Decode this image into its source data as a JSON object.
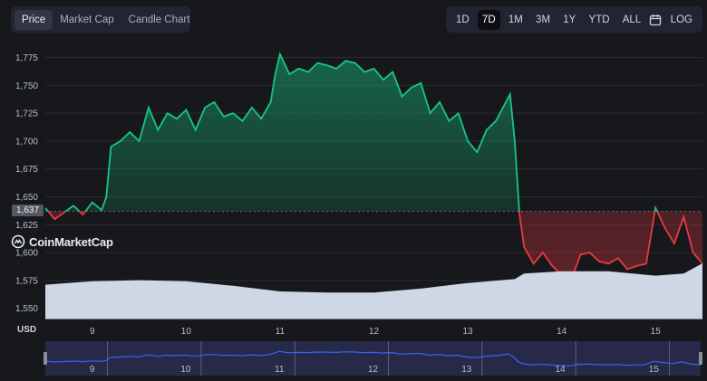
{
  "tabs": {
    "left": [
      {
        "label": "Price",
        "active": true
      },
      {
        "label": "Market Cap",
        "active": false
      },
      {
        "label": "Candle Chart",
        "active": false
      }
    ],
    "ranges": [
      {
        "label": "1D",
        "active": false
      },
      {
        "label": "7D",
        "active": true
      },
      {
        "label": "1M",
        "active": false
      },
      {
        "label": "3M",
        "active": false
      },
      {
        "label": "1Y",
        "active": false
      },
      {
        "label": "YTD",
        "active": false
      },
      {
        "label": "ALL",
        "active": false
      }
    ],
    "calendar_icon": "calendar-icon",
    "log_label": "LOG"
  },
  "watermark": "CoinMarketCap",
  "currency_label": "USD",
  "current_price_label": "1,637",
  "colors": {
    "up": "#16c784",
    "down": "#ea3943",
    "volume": "#cfd6e4",
    "navigator_line": "#3861fb",
    "background": "#17181b"
  },
  "chart_data": {
    "type": "line",
    "ylim": [
      1540,
      1790
    ],
    "yticks": [
      1550,
      1575,
      1600,
      1625,
      1650,
      1675,
      1700,
      1725,
      1750,
      1775
    ],
    "ytick_labels": [
      "1,550",
      "1,575",
      "1,600",
      "1,625",
      "1,650",
      "1,675",
      "1,700",
      "1,725",
      "1,750",
      "1,775"
    ],
    "xlim": [
      8.5,
      15.5
    ],
    "xticks": [
      9,
      10,
      11,
      12,
      13,
      14,
      15
    ],
    "xtick_labels": [
      "9",
      "10",
      "11",
      "12",
      "13",
      "14",
      "15"
    ],
    "reference_price": 1637,
    "price_series": {
      "x": [
        8.5,
        8.6,
        8.7,
        8.8,
        8.9,
        9.0,
        9.1,
        9.15,
        9.2,
        9.3,
        9.4,
        9.5,
        9.6,
        9.7,
        9.8,
        9.9,
        10.0,
        10.1,
        10.2,
        10.3,
        10.4,
        10.5,
        10.6,
        10.7,
        10.8,
        10.9,
        10.95,
        11.0,
        11.1,
        11.2,
        11.3,
        11.4,
        11.5,
        11.6,
        11.7,
        11.8,
        11.9,
        12.0,
        12.1,
        12.2,
        12.3,
        12.4,
        12.5,
        12.6,
        12.7,
        12.8,
        12.9,
        13.0,
        13.1,
        13.2,
        13.3,
        13.45,
        13.5,
        13.55,
        13.6,
        13.7,
        13.8,
        13.9,
        14.0,
        14.1,
        14.2,
        14.3,
        14.4,
        14.5,
        14.6,
        14.7,
        14.8,
        14.9,
        15.0,
        15.1,
        15.2,
        15.3,
        15.4,
        15.5
      ],
      "y": [
        1640,
        1630,
        1636,
        1642,
        1634,
        1645,
        1638,
        1650,
        1695,
        1700,
        1708,
        1700,
        1730,
        1710,
        1725,
        1720,
        1728,
        1710,
        1730,
        1735,
        1722,
        1725,
        1718,
        1730,
        1720,
        1735,
        1760,
        1778,
        1760,
        1765,
        1762,
        1770,
        1768,
        1765,
        1772,
        1770,
        1762,
        1765,
        1755,
        1762,
        1740,
        1748,
        1752,
        1725,
        1735,
        1718,
        1725,
        1700,
        1690,
        1710,
        1718,
        1742,
        1700,
        1635,
        1605,
        1590,
        1600,
        1588,
        1580,
        1575,
        1598,
        1600,
        1592,
        1590,
        1595,
        1585,
        1588,
        1590,
        1640,
        1622,
        1608,
        1632,
        1600,
        1590
      ]
    },
    "volume_series": {
      "x": [
        8.5,
        9.0,
        9.5,
        10.0,
        10.5,
        11.0,
        11.5,
        12.0,
        12.5,
        13.0,
        13.5,
        13.6,
        14.0,
        14.5,
        15.0,
        15.3,
        15.5
      ],
      "y": [
        0.62,
        0.68,
        0.7,
        0.68,
        0.6,
        0.5,
        0.48,
        0.48,
        0.55,
        0.65,
        0.72,
        0.82,
        0.86,
        0.86,
        0.78,
        0.82,
        1.0
      ]
    },
    "navigator": {
      "xticks": [
        9,
        10,
        11,
        12,
        13,
        14,
        15
      ],
      "xtick_labels": [
        "9",
        "10",
        "11",
        "12",
        "13",
        "14",
        "15"
      ]
    }
  }
}
